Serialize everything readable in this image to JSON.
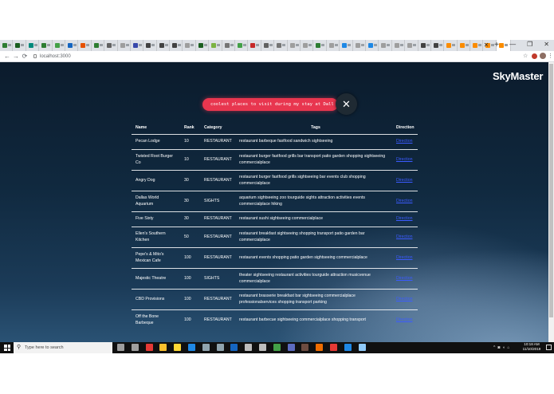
{
  "browser": {
    "tab_favicon_colors": [
      "#2e7d32",
      "#1b5e20",
      "#00897b",
      "#2e7d32",
      "#43a047",
      "#1565c0",
      "#e65100",
      "#2e7d32",
      "#616161",
      "#9e9e9e",
      "#3949ab",
      "#424242",
      "#424242",
      "#424242",
      "#9e9e9e",
      "#1b5e20",
      "#7cb342",
      "#757575",
      "#43a047",
      "#c62828",
      "#616161",
      "#757575",
      "#9e9e9e",
      "#9e9e9e",
      "#2e7d32",
      "#9e9e9e",
      "#1e88e5",
      "#9e9e9e",
      "#1e88e5",
      "#9e9e9e",
      "#9e9e9e",
      "#9e9e9e",
      "#424242",
      "#424242",
      "#fb8c00",
      "#fb8c00",
      "#fb8c00",
      "#fb8c00",
      "#fb8c00"
    ],
    "tab_close": "✕",
    "new_tab": "+",
    "window_controls": [
      "—",
      "❐",
      "✕"
    ],
    "back": "←",
    "forward": "→",
    "reload": "⟳",
    "url": "localhost:3000",
    "star": "☆",
    "menu": "⋮"
  },
  "app": {
    "brand": "SkyMaster",
    "search_query": "coolest places to visit during my stay at Dallas?",
    "close_glyph": "✕"
  },
  "table": {
    "headers": {
      "name": "Name",
      "rank": "Rank",
      "category": "Category",
      "tags": "Tags",
      "direction": "Direction"
    },
    "rows": [
      {
        "name": "Pecan Lodge",
        "rank": "10",
        "category": "RESTAURANT",
        "tags": "restaurant barbeque fastfood sandwich sightseeing",
        "direction": "Direction"
      },
      {
        "name": "Twisted Root Burger Co",
        "rank": "10",
        "category": "RESTAURANT",
        "tags": "restaurant burger fastfood grills bar transport patio garden shopping sightseeing commercialplace",
        "direction": "Direction"
      },
      {
        "name": "Angry Dog",
        "rank": "30",
        "category": "RESTAURANT",
        "tags": "restaurant burger fastfood grills sightseeing bar events club shopping commercialplace",
        "direction": "Direction"
      },
      {
        "name": "Dallas World Aquarium",
        "rank": "30",
        "category": "SIGHTS",
        "tags": "aquarium sightseeing zoo tourguide sights attraction activities events commercialplace hiking",
        "direction": "Direction"
      },
      {
        "name": "Five Sixty",
        "rank": "30",
        "category": "RESTAURANT",
        "tags": "restaurant sushi sightseeing commercialplace",
        "direction": "Direction"
      },
      {
        "name": "Ellen's Southern Kitchen",
        "rank": "50",
        "category": "RESTAURANT",
        "tags": "restaurant breakfast sightseeing shopping transport patio garden bar commercialplace",
        "direction": "Direction"
      },
      {
        "name": "Pepe's & Mito's Mexican Cafe",
        "rank": "100",
        "category": "RESTAURANT",
        "tags": "restaurant events shopping patio garden sightseeing commercialplace",
        "direction": "Direction"
      },
      {
        "name": "Majestic Theatre",
        "rank": "100",
        "category": "SIGHTS",
        "tags": "theater sightseeing restaurant activities tourguide attraction musicvenue commercialplace",
        "direction": "Direction"
      },
      {
        "name": "CBD Provisions",
        "rank": "100",
        "category": "RESTAURANT",
        "tags": "restaurant brasserie breakfast bar sightseeing commercialplace professionalservices shopping transport parking",
        "direction": "Direction"
      },
      {
        "name": "Off the Bone Barbeque",
        "rank": "100",
        "category": "RESTAURANT",
        "tags": "restaurant barbecue sightseeing commercialplace shopping transport",
        "direction": "Direction"
      }
    ]
  },
  "taskbar": {
    "search_placeholder": "Type here to search",
    "search_glyph": "⚲",
    "app_icon_colors": [
      "#9e9e9e",
      "#9e9e9e",
      "#e53935",
      "#fbc02d",
      "#fdd835",
      "#1e88e5",
      "#90a4ae",
      "#90a4ae",
      "#1565c0",
      "#bdbdbd",
      "#bdbdbd",
      "#43a047",
      "#5c6bc0",
      "#6d4c41",
      "#ef6c00",
      "#e53935",
      "#1e88e5",
      "#90caf9"
    ],
    "tray_glyphs": [
      "^",
      "◙",
      "◖",
      "⌂"
    ],
    "clock_time": "10:18 AM",
    "clock_date": "11/10/2019"
  }
}
